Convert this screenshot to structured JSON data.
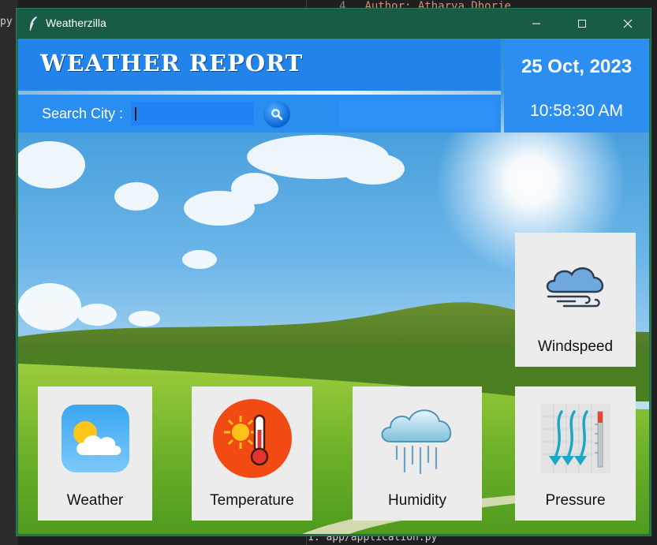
{
  "background": {
    "left_tab": "py",
    "code_line_number": "4",
    "code_line": "Author: Atharva Dhorje",
    "bottom_line": "1. app/application.py"
  },
  "window": {
    "title": "Weatherzilla",
    "controls": {
      "minimize": "—",
      "maximize": "☐",
      "close": "✕"
    }
  },
  "header": {
    "title": "WEATHER REPORT",
    "search_label": "Search City :",
    "search_value": "",
    "result_text": "",
    "date": "25 Oct, 2023",
    "time": "10:58:30 AM"
  },
  "cards": {
    "windspeed": {
      "label": "Windspeed",
      "icon": "wind-cloud-icon"
    },
    "weather": {
      "label": "Weather",
      "icon": "sun-cloud-icon"
    },
    "temperature": {
      "label": "Temperature",
      "icon": "thermometer-sun-icon"
    },
    "humidity": {
      "label": "Humidity",
      "icon": "rain-cloud-icon"
    },
    "pressure": {
      "label": "Pressure",
      "icon": "pressure-arrows-icon"
    }
  },
  "colors": {
    "titlebar": "#185c43",
    "header_blue": "#2284ea",
    "card_bg": "#ececec"
  }
}
